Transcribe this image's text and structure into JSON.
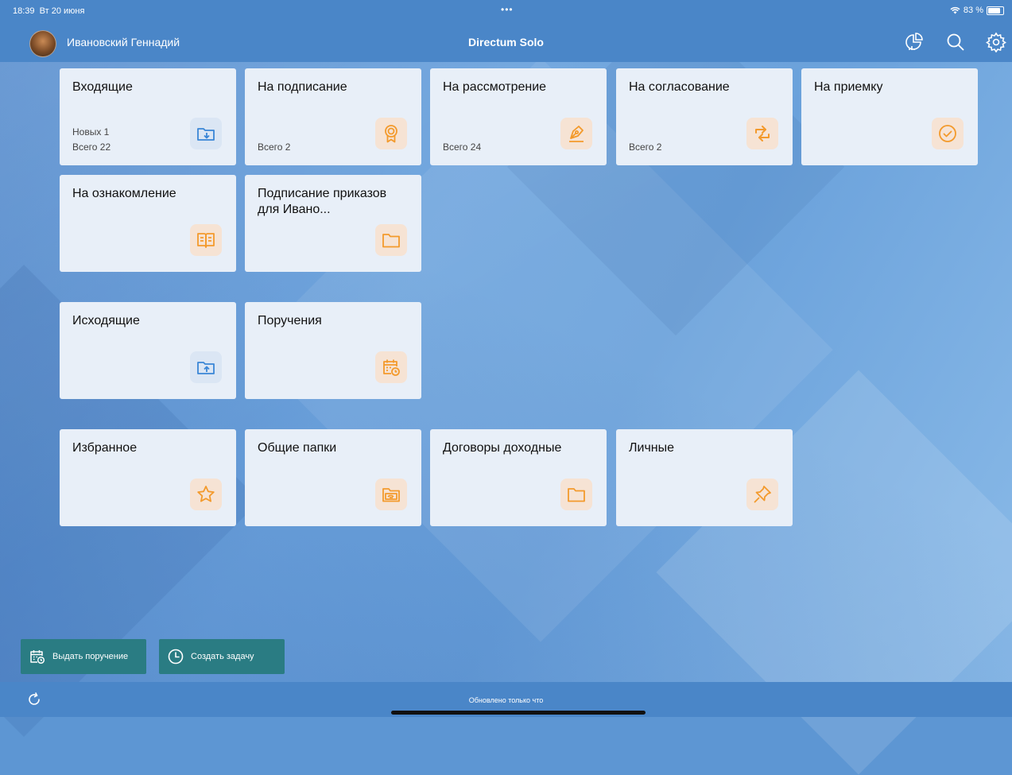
{
  "status_bar": {
    "time": "18:39",
    "date": "Вт 20 июня",
    "dots": "•••",
    "battery": "83 %"
  },
  "header": {
    "user_name": "Ивановский Геннадий",
    "app_title": "Directum Solo"
  },
  "tiles": [
    {
      "title": "Входящие",
      "sub1": "Новых 1",
      "sub2": "Всего 22",
      "icon": "folder-download-icon"
    },
    {
      "title": "На подписание",
      "sub2": "Всего 2",
      "icon": "award-icon"
    },
    {
      "title": "На рассмотрение",
      "sub2": "Всего 24",
      "icon": "pen-icon"
    },
    {
      "title": "На согласование",
      "sub2": "Всего 2",
      "icon": "sync-icon"
    },
    {
      "title": "На приемку",
      "icon": "check-circle-icon"
    },
    {
      "title": "На ознакомление",
      "icon": "book-icon"
    },
    {
      "title": "Подписание приказов для Ивано...",
      "icon": "folder-icon"
    },
    {
      "title": "Исходящие",
      "icon": "folder-upload-icon"
    },
    {
      "title": "Поручения",
      "icon": "calendar-clock-icon"
    },
    {
      "title": "Избранное",
      "icon": "star-icon"
    },
    {
      "title": "Общие папки",
      "icon": "shared-folder-icon"
    },
    {
      "title": "Договоры доходные",
      "icon": "folder-icon"
    },
    {
      "title": "Личные",
      "icon": "pin-icon"
    }
  ],
  "actions": {
    "assign_label": "Выдать поручение",
    "create_task_label": "Создать задачу"
  },
  "footer": {
    "updated_text": "Обновлено только что"
  },
  "colors": {
    "bar": "#4a86c8",
    "action_button": "#2a7c83",
    "tile": "#e8eff8",
    "icon_blue": "#3a86d6",
    "icon_orange": "#f39a2c"
  }
}
